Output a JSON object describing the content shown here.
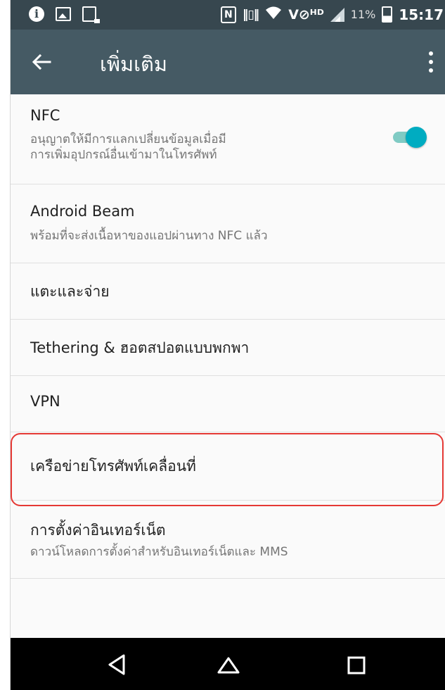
{
  "status_bar": {
    "icons": [
      "info-icon",
      "image-icon",
      "screenshot-icon",
      "nfc-icon",
      "vibrate-icon",
      "wifi-icon",
      "volte-icon",
      "signal-icon",
      "battery-icon"
    ],
    "battery_percent": "11%",
    "time": "15:17",
    "nfc_glyph": "N",
    "volte_text": "V⊘ᴴᴰ"
  },
  "app_bar": {
    "title": "เพิ่มเติม",
    "background": "#455a64"
  },
  "list": {
    "nfc": {
      "title": "NFC",
      "subtitle_line1": "อนุญาตให้มีการแลกเปลี่ยนข้อมูลเมื่อมี",
      "subtitle_line2": "การเพิ่มอุปกรณ์อื่นเข้ามาในโทรศัพท์",
      "toggle_on": true
    },
    "android_beam": {
      "title": "Android Beam",
      "subtitle": "พร้อมที่จะส่งเนื้อหาของแอปผ่านทาง NFC แล้ว"
    },
    "tap_and_pay": {
      "title": "แตะและจ่าย"
    },
    "tethering": {
      "title": "Tethering & ฮอตสปอตแบบพกพา"
    },
    "vpn": {
      "title": "VPN"
    },
    "mobile_network": {
      "title": "เครือข่ายโทรศัพท์เคลื่อนที่"
    },
    "internet_settings": {
      "title": "การตั้งค่าอินเทอร์เน็ต",
      "subtitle": "ดาวน์โหลดการตั้งค่าสำหรับอินเทอร์เน็ตและ MMS"
    }
  },
  "colors": {
    "status_bar": "#37474f",
    "accent": "#00acc1",
    "highlight": "#e53935"
  }
}
